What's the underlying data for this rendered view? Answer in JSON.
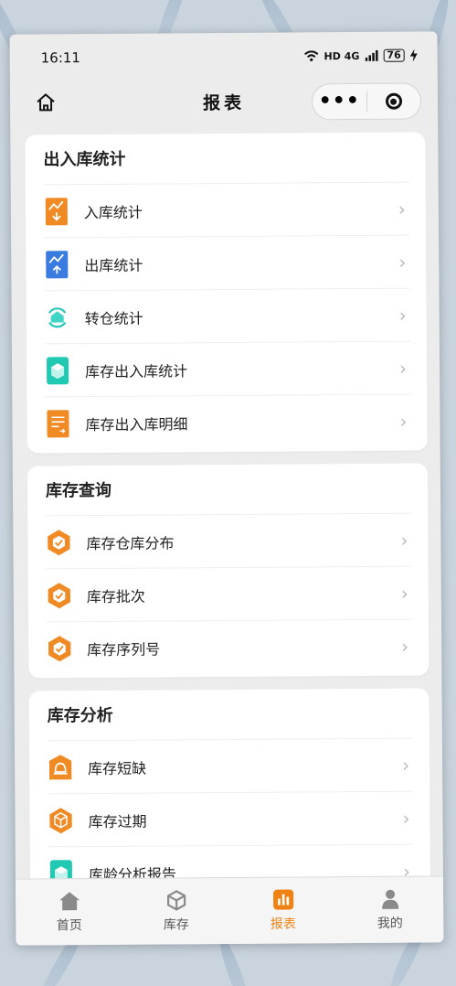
{
  "status": {
    "time": "16:11",
    "network": "HD 4G",
    "battery": "76"
  },
  "nav": {
    "title": "报表",
    "more_label": "•••"
  },
  "sections": [
    {
      "title": "出入库统计",
      "items": [
        {
          "label": "入库统计",
          "icon": "inbound-chart-icon",
          "color": "#f08a24"
        },
        {
          "label": "出库统计",
          "icon": "outbound-chart-icon",
          "color": "#3a7be0"
        },
        {
          "label": "转仓统计",
          "icon": "transfer-cycle-icon",
          "color": "#27c7b8"
        },
        {
          "label": "库存出入库统计",
          "icon": "cube-stats-icon",
          "color": "#20c9b2"
        },
        {
          "label": "库存出入库明细",
          "icon": "detail-list-icon",
          "color": "#f08a24"
        }
      ]
    },
    {
      "title": "库存查询",
      "items": [
        {
          "label": "库存仓库分布",
          "icon": "hex-check-icon",
          "color": "#f08a24"
        },
        {
          "label": "库存批次",
          "icon": "hex-check-icon",
          "color": "#f08a24"
        },
        {
          "label": "库存序列号",
          "icon": "hex-check-icon",
          "color": "#f08a24"
        }
      ]
    },
    {
      "title": "库存分析",
      "items": [
        {
          "label": "库存短缺",
          "icon": "bell-shortage-icon",
          "color": "#f08a24"
        },
        {
          "label": "库存过期",
          "icon": "box-expired-icon",
          "color": "#f08a24"
        },
        {
          "label": "库龄分析报告",
          "icon": "cube-report-icon",
          "color": "#20c9b2"
        }
      ]
    }
  ],
  "tabs": [
    {
      "label": "首页",
      "icon": "home-icon"
    },
    {
      "label": "库存",
      "icon": "inventory-box-icon"
    },
    {
      "label": "报表",
      "icon": "report-bars-icon",
      "active": true
    },
    {
      "label": "我的",
      "icon": "user-icon"
    }
  ],
  "accent": "#f08214"
}
